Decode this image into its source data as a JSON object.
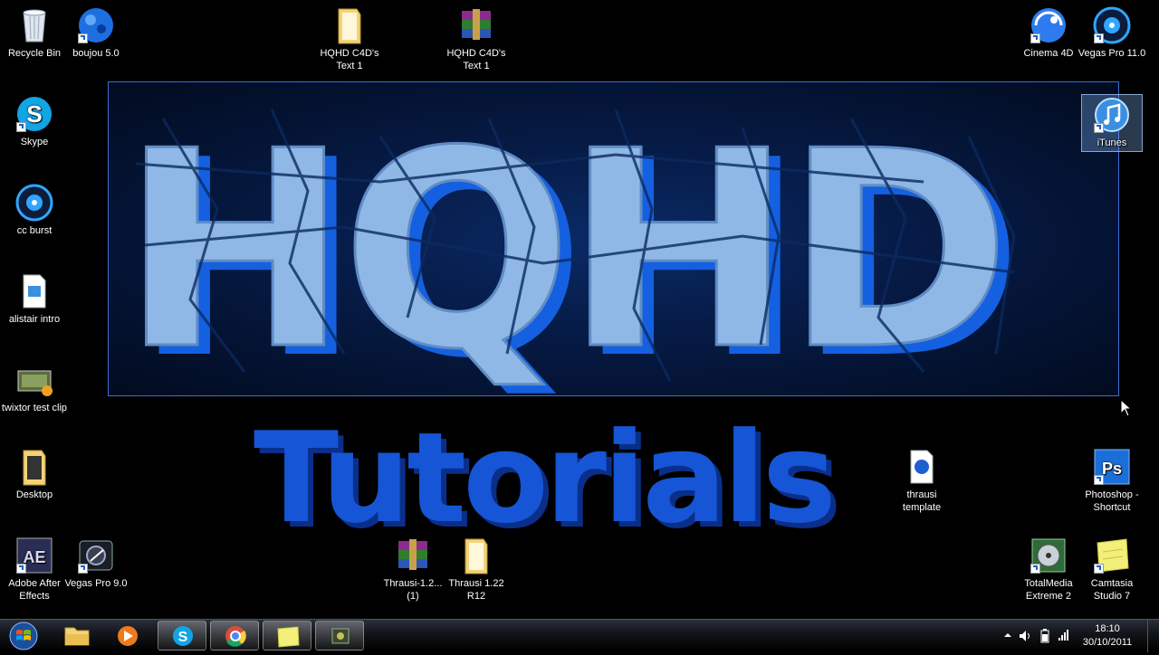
{
  "wallpaper": {
    "title": "HQHD",
    "subtitle": "Tutorials"
  },
  "desktop_icons": {
    "recycle_bin": "Recycle Bin",
    "boujou": "boujou 5.0",
    "hqhd_folder": "HQHD C4D's Text 1",
    "hqhd_archive": "HQHD C4D's Text 1",
    "cinema4d": "Cinema 4D",
    "vegas11": "Vegas Pro 11.0",
    "skype": "Skype",
    "itunes": "iTunes",
    "cc_burst": "cc burst",
    "alistair": "alistair intro",
    "twixtor": "twixtor test clip",
    "desktop": "Desktop",
    "thrausi_template": "thrausi template",
    "photoshop": "Photoshop - Shortcut",
    "after_effects": "Adobe After Effects",
    "vegas9": "Vegas Pro 9.0",
    "thrausi_archive": "Thrausi-1.2... (1)",
    "thrausi_folder": "Thrausi 1.22 R12",
    "totalmedia": "TotalMedia Extreme 2",
    "camtasia": "Camtasia Studio 7"
  },
  "taskbar": {
    "pinned": [
      "windows-explorer",
      "media-player",
      "skype",
      "chrome",
      "sticky-notes",
      "camtasia-recorder"
    ]
  },
  "clock": {
    "time": "18:10",
    "date": "30/10/2011"
  },
  "colors": {
    "accent_blue": "#1a5fd0",
    "letter_face": "#8fb8e6",
    "letter_shadow": "#1560e0"
  }
}
